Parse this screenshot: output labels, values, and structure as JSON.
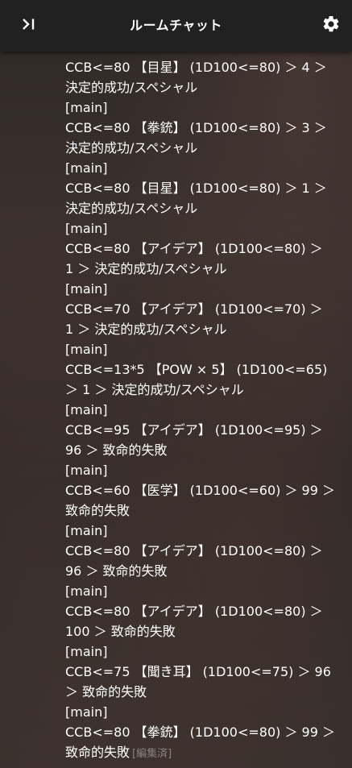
{
  "header": {
    "title": "ルームチャット",
    "left_icon": "collapse-panel-icon",
    "right_icon": "gear-icon"
  },
  "messages": [
    {
      "lines": [
        "CCB<=80 【目星】 (1D100<=80) ＞ 4 ＞",
        "決定的成功/スペシャル"
      ]
    },
    {
      "lines": [
        "[main]",
        "CCB<=80 【拳銃】 (1D100<=80) ＞ 3 ＞",
        "決定的成功/スペシャル"
      ]
    },
    {
      "lines": [
        "[main]",
        "CCB<=80 【目星】 (1D100<=80) ＞ 1 ＞",
        "決定的成功/スペシャル"
      ]
    },
    {
      "lines": [
        "[main]",
        "CCB<=80 【アイデア】 (1D100<=80) ＞",
        "1 ＞ 決定的成功/スペシャル"
      ]
    },
    {
      "lines": [
        "[main]",
        "CCB<=70 【アイデア】 (1D100<=70) ＞",
        "1 ＞ 決定的成功/スペシャル"
      ]
    },
    {
      "lines": [
        "[main]",
        "CCB<=13*5 【POW × 5】 (1D100<=65)",
        "＞ 1 ＞ 決定的成功/スペシャル"
      ]
    },
    {
      "lines": [
        "[main]",
        "CCB<=95 【アイデア】 (1D100<=95) ＞",
        "96 ＞ 致命的失敗"
      ]
    },
    {
      "lines": [
        "[main]",
        "CCB<=60 【医学】 (1D100<=60) ＞ 99 ＞",
        "致命的失敗"
      ]
    },
    {
      "lines": [
        "[main]",
        "CCB<=80 【アイデア】 (1D100<=80) ＞",
        "96 ＞ 致命的失敗"
      ]
    },
    {
      "lines": [
        "[main]",
        "CCB<=80 【アイデア】 (1D100<=80) ＞",
        "100 ＞ 致命的失敗"
      ]
    },
    {
      "lines": [
        "[main]",
        "CCB<=75 【聞き耳】 (1D100<=75) ＞ 96",
        "＞ 致命的失敗"
      ]
    },
    {
      "lines": [
        "[main]",
        "CCB<=80 【拳銃】 (1D100<=80) ＞ 99 ＞",
        "致命的失敗"
      ],
      "edited": "[編集済]"
    }
  ]
}
